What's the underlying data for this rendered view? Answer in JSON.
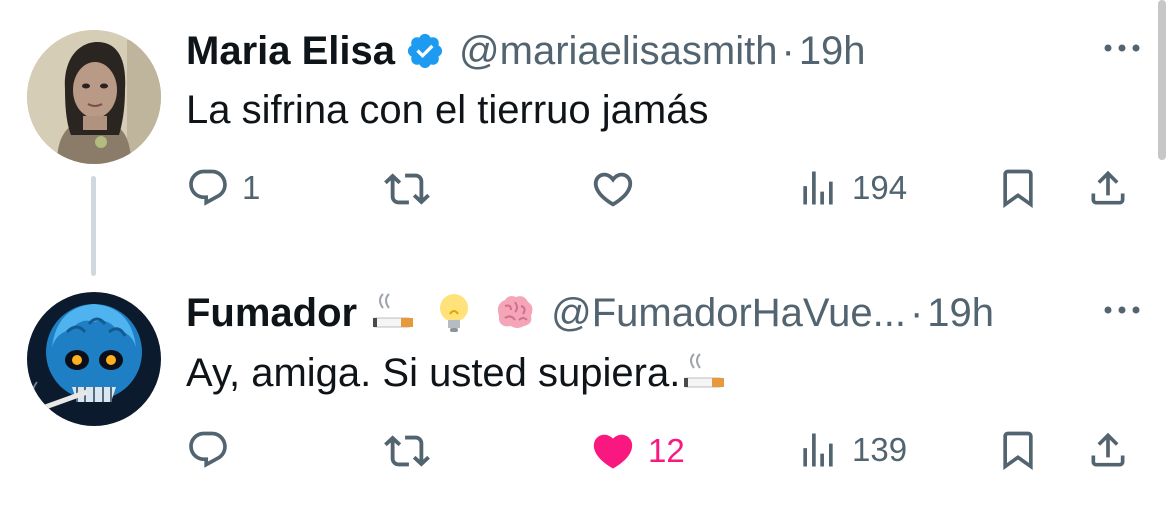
{
  "tweets": [
    {
      "name": "Maria Elisa",
      "verified": true,
      "handle": "@mariaelisasmith",
      "separator": "·",
      "time": "19h",
      "text": "La sifrina con el tierruo jamás",
      "reply_count": "1",
      "retweet_count": "",
      "like_count": "",
      "liked": false,
      "view_count": "194"
    },
    {
      "name": "Fumador",
      "name_emojis": [
        "cigarette-emoji",
        "light-bulb-emoji",
        "brain-emoji"
      ],
      "handle": "@FumadorHaVue...",
      "separator": "·",
      "time": "19h",
      "text": "Ay, amiga. Si usted supiera.",
      "text_emoji": "cigarette-emoji",
      "reply_count": "",
      "retweet_count": "",
      "like_count": "12",
      "liked": true,
      "view_count": "139"
    }
  ],
  "colors": {
    "verified_blue": "#1d9bf0",
    "like_pink": "#f91880",
    "secondary_text": "#536471",
    "thread_line": "#cfd9de"
  }
}
